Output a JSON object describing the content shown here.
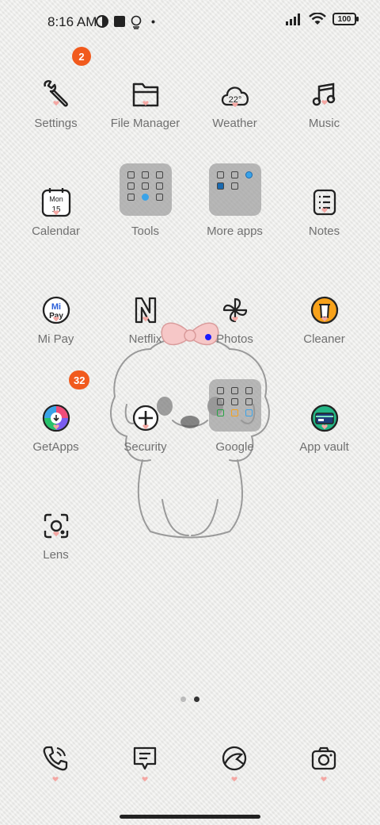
{
  "status_bar": {
    "time": "8:16 AM",
    "battery": "100",
    "icons": [
      "contrast-icon",
      "square-icon",
      "lightbulb-icon",
      "dot-icon",
      "signal-icon",
      "wifi-icon"
    ]
  },
  "apps": [
    {
      "label": "Settings",
      "icon": "wrench-icon",
      "badge": "2"
    },
    {
      "label": "File Manager",
      "icon": "folder-icon"
    },
    {
      "label": "Weather",
      "icon": "cloud-icon",
      "icon_text": "22°"
    },
    {
      "label": "Music",
      "icon": "music-note-icon"
    },
    {
      "label": "Calendar",
      "icon": "calendar-icon",
      "icon_day": "Mon",
      "icon_date": "15"
    },
    {
      "label": "Tools",
      "icon": "folder-tools"
    },
    {
      "label": "More apps",
      "icon": "folder-more-apps"
    },
    {
      "label": "Notes",
      "icon": "notes-icon"
    },
    {
      "label": "Mi Pay",
      "icon": "mipay-icon",
      "icon_text_top": "Mi",
      "icon_text_bottom": "Pay"
    },
    {
      "label": "Netflix",
      "icon": "netflix-icon"
    },
    {
      "label": "Photos",
      "icon": "pinwheel-icon"
    },
    {
      "label": "Cleaner",
      "icon": "trash-icon"
    },
    {
      "label": "GetApps",
      "icon": "getapps-icon",
      "badge": "32"
    },
    {
      "label": "Security",
      "icon": "shield-plus-icon"
    },
    {
      "label": "Google",
      "icon": "folder-google"
    },
    {
      "label": "App vault",
      "icon": "app-vault-icon"
    },
    {
      "label": "Lens",
      "icon": "lens-icon"
    }
  ],
  "dock": [
    {
      "name": "phone",
      "icon": "phone-icon"
    },
    {
      "name": "messages",
      "icon": "message-icon"
    },
    {
      "name": "browser",
      "icon": "browser-icon"
    },
    {
      "name": "camera",
      "icon": "camera-icon"
    }
  ],
  "colors": {
    "badge": "#f15a1d",
    "heart": "#f4a7a3",
    "label": "#707070"
  },
  "pages": {
    "count": 2,
    "active": 2
  }
}
